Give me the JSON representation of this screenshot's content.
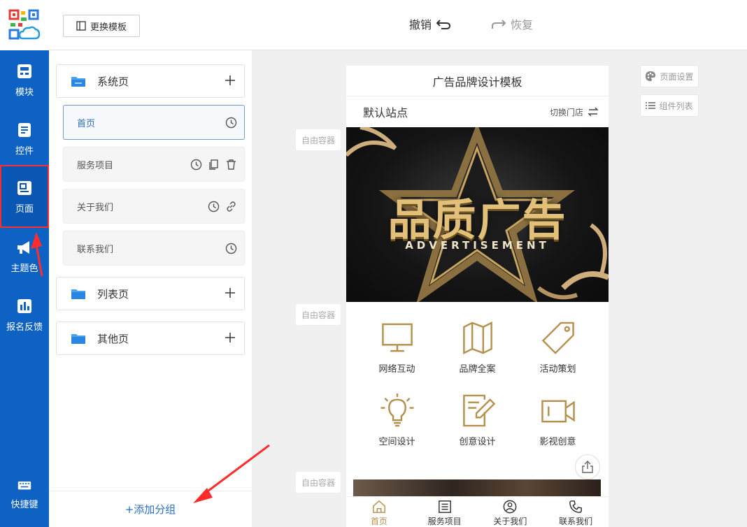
{
  "sidebar": {
    "items": [
      {
        "label": "模块",
        "icon": "module-icon"
      },
      {
        "label": "控件",
        "icon": "widget-icon"
      },
      {
        "label": "页面",
        "icon": "page-icon"
      },
      {
        "label": "主题色",
        "icon": "megaphone-icon"
      },
      {
        "label": "报名反馈",
        "icon": "bar-chart-icon"
      }
    ],
    "bottom": {
      "label": "快捷键",
      "icon": "keyboard-icon"
    }
  },
  "toolbar": {
    "template_label": "更换模板",
    "undo_label": "撤销",
    "redo_label": "恢复"
  },
  "pages": {
    "groups": [
      {
        "name": "系统页"
      },
      {
        "name": "列表页"
      },
      {
        "name": "其他页"
      }
    ],
    "items": [
      {
        "label": "首页"
      },
      {
        "label": "服务项目"
      },
      {
        "label": "关于我们"
      },
      {
        "label": "联系我们"
      }
    ],
    "add_group_label": "+添加分组"
  },
  "canvas": {
    "container_tag": "自由容器",
    "page_settings_label": "页面设置",
    "component_list_label": "组件列表"
  },
  "phone": {
    "title": "广告品牌设计模板",
    "store_name": "默认站点",
    "switch_store_label": "切换门店",
    "banner": {
      "title": "品质广告",
      "subtitle": "ADVERTISEMENT"
    },
    "grid": [
      {
        "label": "网络互动",
        "icon": "monitor-icon"
      },
      {
        "label": "品牌全案",
        "icon": "map-icon"
      },
      {
        "label": "活动策划",
        "icon": "tag-icon"
      },
      {
        "label": "空间设计",
        "icon": "lightbulb-icon"
      },
      {
        "label": "创意设计",
        "icon": "edit-doc-icon"
      },
      {
        "label": "影视创意",
        "icon": "video-icon"
      }
    ],
    "tabs": [
      {
        "label": "首页",
        "icon": "home-icon"
      },
      {
        "label": "服务项目",
        "icon": "list-icon"
      },
      {
        "label": "关于我们",
        "icon": "user-icon"
      },
      {
        "label": "联系我们",
        "icon": "phone-icon"
      }
    ]
  },
  "colors": {
    "sidebar_blue": "#0d62c4",
    "accent_gold": "#b6904f",
    "annotation_red": "#ff2d2d",
    "link_blue": "#2b6fbf"
  }
}
